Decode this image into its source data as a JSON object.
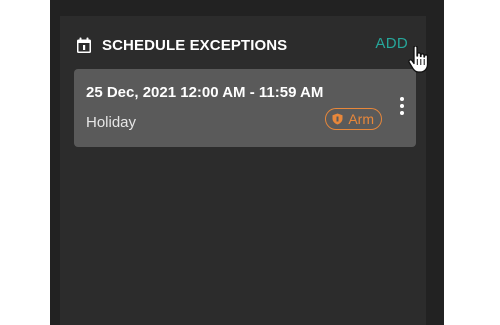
{
  "panel": {
    "title": "SCHEDULE EXCEPTIONS",
    "add_label": "ADD"
  },
  "exceptions": [
    {
      "date_range": "25 Dec, 2021 12:00 AM - 11:59 AM",
      "type": "Holiday",
      "mode_badge": "Arm"
    }
  ],
  "colors": {
    "accent_add": "#26a69a",
    "badge_orange": "#e8873a"
  },
  "icons": {
    "header": "calendar-icon",
    "badge": "shield-icon",
    "menu": "kebab-menu-icon",
    "pointer": "hand-cursor-icon"
  }
}
